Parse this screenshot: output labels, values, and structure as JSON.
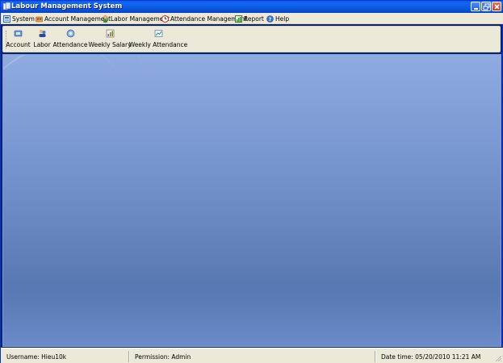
{
  "window": {
    "title": "Labour Management System",
    "icon": "app-icon",
    "controls": [
      "minimize-icon",
      "restore-icon",
      "close-icon"
    ]
  },
  "menubar": {
    "items": [
      {
        "label": "System",
        "icon": "system-icon"
      },
      {
        "label": "Account Management",
        "icon": "account-management-icon"
      },
      {
        "label": "Labor Management",
        "icon": "labor-management-icon"
      },
      {
        "label": "Attendance Management",
        "icon": "attendance-management-icon"
      },
      {
        "label": "Report",
        "icon": "report-icon"
      },
      {
        "label": "Help",
        "icon": "help-icon"
      }
    ]
  },
  "toolbar": {
    "buttons": [
      {
        "label": "Account",
        "icon": "account-icon"
      },
      {
        "label": "Labor",
        "icon": "labor-icon"
      },
      {
        "label": "Attendance",
        "icon": "attendance-icon"
      },
      {
        "label": "Weekly Salary",
        "icon": "weekly-salary-icon"
      },
      {
        "label": "Weekly Attendance",
        "icon": "weekly-attendance-icon"
      }
    ]
  },
  "statusbar": {
    "username": "Username: Hieu10k",
    "permission": "Permission: Admin",
    "datetime": "Date time: 05/20/2010 11:21 AM"
  },
  "colors": {
    "titlebar": "#0a5ce6",
    "workspace_top": "#8fabe0",
    "workspace_bottom": "#5878b2",
    "chrome": "#ece9d8"
  }
}
